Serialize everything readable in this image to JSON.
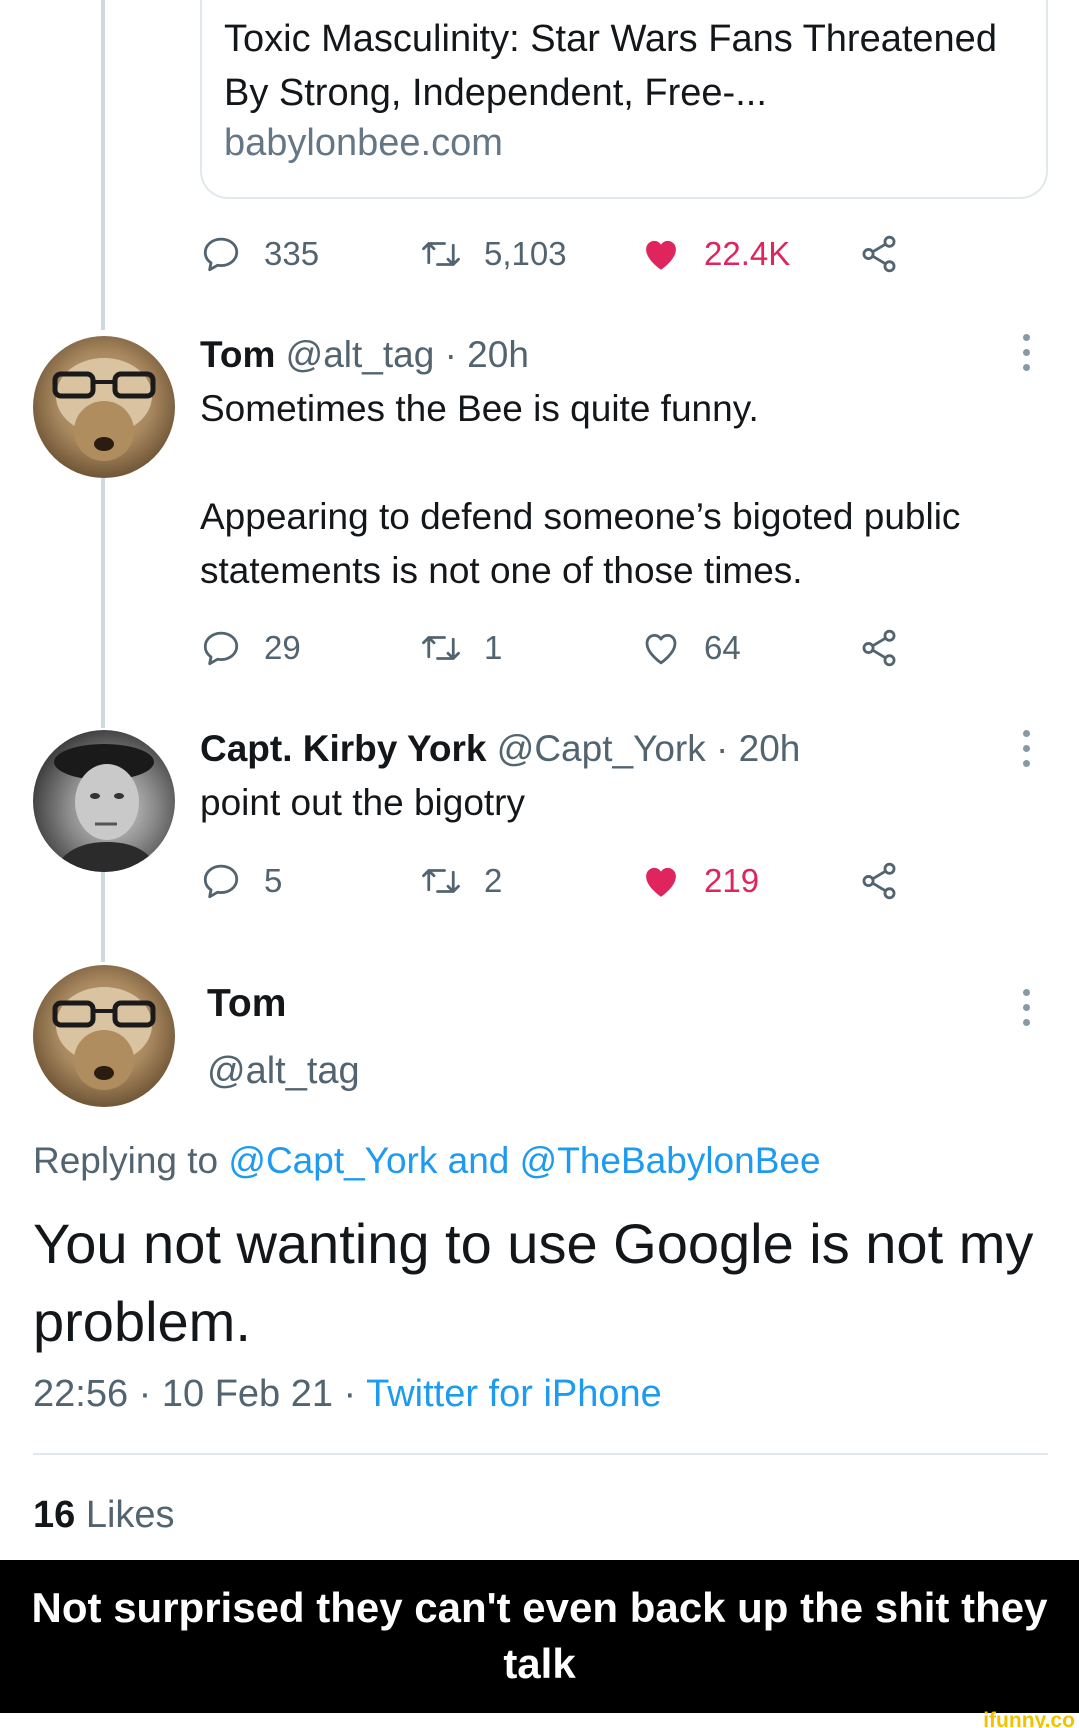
{
  "link_card": {
    "title": "Toxic Masculinity: Star Wars Fans Threatened By Strong, Independent, Free-...",
    "domain": "babylonbee.com"
  },
  "tweet0_actions": {
    "replies": "335",
    "retweets": "5,103",
    "likes": "22.4K",
    "liked": true
  },
  "tweet1": {
    "name": "Tom",
    "handle": "@alt_tag",
    "time": "· 20h",
    "text_line1": "Sometimes the Bee is quite funny.",
    "text_para2": "Appearing to defend someone’s bigoted public statements is not one of those times.",
    "actions": {
      "replies": "29",
      "retweets": "1",
      "likes": "64",
      "liked": false
    }
  },
  "tweet2": {
    "name": "Capt. Kirby York",
    "handle": "@Capt_York",
    "time": "· 20h",
    "text": "point out the bigotry",
    "actions": {
      "replies": "5",
      "retweets": "2",
      "likes": "219",
      "liked": true
    }
  },
  "main_tweet": {
    "name": "Tom",
    "handle": "@alt_tag",
    "replying_prefix": "Replying to",
    "replying_user1": "@Capt_York",
    "replying_and": "and",
    "replying_user2": "@TheBabylonBee",
    "text": "You not wanting to use Google is not my problem.",
    "time_date": "22:56 · 10 Feb 21 ·",
    "client": "Twitter for iPhone",
    "likes_count": "16",
    "likes_label": "Likes"
  },
  "caption": "Not surprised they can't even back up the shit they talk",
  "watermark": "ifunny.co",
  "colors": {
    "like_red": "#e0245e",
    "link_blue": "#1d9bf0",
    "muted": "#536471"
  }
}
